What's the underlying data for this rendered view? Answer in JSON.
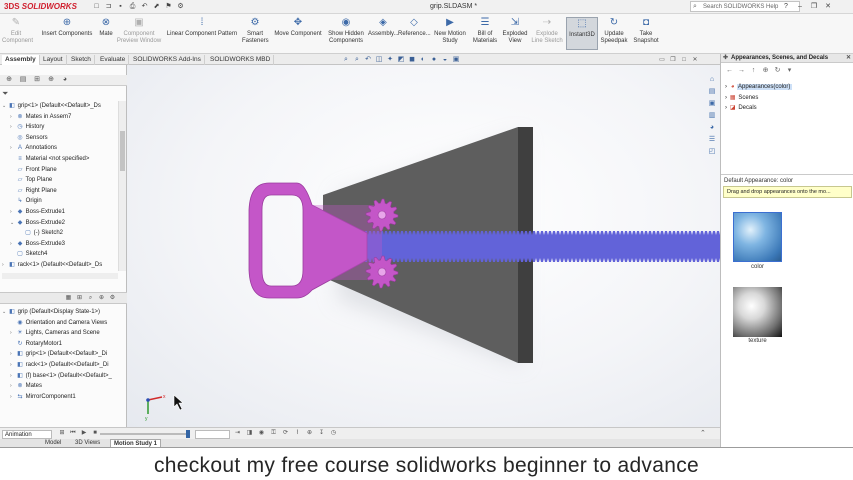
{
  "titlebar": {
    "logo_brand": "3DS",
    "logo_text": "SOLIDWORKS",
    "document_title": "grip.SLDASM *",
    "search_placeholder": "Search SOLIDWORKS Help",
    "qa_icons": [
      "new-icon",
      "open-icon",
      "save-icon",
      "print-icon",
      "undo-icon",
      "select-icon",
      "rebuild-icon",
      "options-icon"
    ]
  },
  "ribbon": {
    "items": [
      {
        "label": "Edit\nComponent",
        "icon": "✎",
        "state": "disabled"
      },
      {
        "label": "Insert Components",
        "icon": "⊕",
        "state": "normal"
      },
      {
        "label": "Mate",
        "icon": "⊗",
        "state": "normal"
      },
      {
        "label": "Component\nPreview Window",
        "icon": "▣",
        "state": "disabled"
      },
      {
        "label": "Linear Component Pattern",
        "icon": "⁞",
        "state": "normal"
      },
      {
        "label": "Smart\nFasteners",
        "icon": "⚙",
        "state": "normal"
      },
      {
        "label": "Move Component",
        "icon": "✥",
        "state": "normal"
      },
      {
        "label": "Show Hidden\nComponents",
        "icon": "◉",
        "state": "normal"
      },
      {
        "label": "Assembly...",
        "icon": "◈",
        "state": "normal"
      },
      {
        "label": "Reference...",
        "icon": "◇",
        "state": "normal"
      },
      {
        "label": "New Motion\nStudy",
        "icon": "▶",
        "state": "normal"
      },
      {
        "label": "Bill of\nMaterials",
        "icon": "☰",
        "state": "normal"
      },
      {
        "label": "Exploded\nView",
        "icon": "⇲",
        "state": "normal"
      },
      {
        "label": "Explode\nLine Sketch",
        "icon": "⇢",
        "state": "disabled"
      },
      {
        "label": "Instant3D",
        "icon": "⬚",
        "state": "active"
      },
      {
        "label": "Update\nSpeedpak",
        "icon": "↻",
        "state": "normal"
      },
      {
        "label": "Take\nSnapshot",
        "icon": "◘",
        "state": "normal"
      }
    ]
  },
  "tabs": [
    "Assembly",
    "Layout",
    "Sketch",
    "Evaluate",
    "SOLIDWORKS Add-Ins",
    "SOLIDWORKS MBD"
  ],
  "feature_tree": {
    "items": [
      {
        "label": "grip<1> (Default<<Default>_Ds",
        "icon": "◧",
        "exp": "⌄",
        "indent": 0
      },
      {
        "label": "Mates in Assem7",
        "icon": "⊗",
        "exp": "›",
        "indent": 1
      },
      {
        "label": "History",
        "icon": "◷",
        "exp": "›",
        "indent": 1
      },
      {
        "label": "Sensors",
        "icon": "◎",
        "exp": "",
        "indent": 1
      },
      {
        "label": "Annotations",
        "icon": "A",
        "exp": "›",
        "indent": 1
      },
      {
        "label": "Material <not specified>",
        "icon": "≡",
        "exp": "",
        "indent": 1
      },
      {
        "label": "Front Plane",
        "icon": "▱",
        "exp": "",
        "indent": 1
      },
      {
        "label": "Top Plane",
        "icon": "▱",
        "exp": "",
        "indent": 1
      },
      {
        "label": "Right Plane",
        "icon": "▱",
        "exp": "",
        "indent": 1
      },
      {
        "label": "Origin",
        "icon": "↳",
        "exp": "",
        "indent": 1
      },
      {
        "label": "Boss-Extrude1",
        "icon": "◆",
        "exp": "›",
        "indent": 1
      },
      {
        "label": "Boss-Extrude2",
        "icon": "◆",
        "exp": "⌄",
        "indent": 1
      },
      {
        "label": "(-) Sketch2",
        "icon": "▢",
        "exp": "",
        "indent": 2
      },
      {
        "label": "Boss-Extrude3",
        "icon": "◆",
        "exp": "›",
        "indent": 1
      },
      {
        "label": "Sketch4",
        "icon": "▢",
        "exp": "",
        "indent": 1
      },
      {
        "label": "rack<1> (Default<<Default>_Ds",
        "icon": "◧",
        "exp": "›",
        "indent": 0
      }
    ]
  },
  "motion_tree": {
    "items": [
      {
        "label": "grip (Default<Display State-1>)",
        "icon": "◧",
        "exp": "⌄",
        "indent": 0
      },
      {
        "label": "Orientation and Camera Views",
        "icon": "◉",
        "exp": "",
        "indent": 1
      },
      {
        "label": "Lights, Cameras and Scene",
        "icon": "☀",
        "exp": "›",
        "indent": 1
      },
      {
        "label": "RotaryMotor1",
        "icon": "↻",
        "exp": "",
        "indent": 1
      },
      {
        "label": "grip<1> (Default<<Default>_Di",
        "icon": "◧",
        "exp": "›",
        "indent": 1
      },
      {
        "label": "rack<1> (Default<<Default>_Di",
        "icon": "◧",
        "exp": "›",
        "indent": 1
      },
      {
        "label": "(f) base<1> (Default<<Default>_",
        "icon": "◧",
        "exp": "›",
        "indent": 1
      },
      {
        "label": "Mates",
        "icon": "⊗",
        "exp": "›",
        "indent": 1
      },
      {
        "label": "MirrorComponent1",
        "icon": "⇆",
        "exp": "›",
        "indent": 1
      }
    ]
  },
  "timeline": {
    "study_type": "Animation",
    "bottom_tabs": [
      "Model",
      "3D Views",
      "Motion Study 1"
    ]
  },
  "task_pane": {
    "title": "Appearances, Scenes, and Decals",
    "tree": [
      {
        "label": "Appearances(color)",
        "icon": "◕",
        "selected": true
      },
      {
        "label": "Scenes",
        "icon": "▦",
        "selected": false
      },
      {
        "label": "Decals",
        "icon": "◪",
        "selected": false
      }
    ],
    "section_label": "Default Appearance: color",
    "hint": "Drag and drop appearances onto the mo...",
    "swatches": [
      "color",
      "texture"
    ]
  },
  "colors": {
    "handle": "#c456c8",
    "rack": "#6263d9",
    "base": "#5e5e5e",
    "accent": "#d01f2e"
  },
  "caption": "checkout my free course solidworks beginner to advance"
}
